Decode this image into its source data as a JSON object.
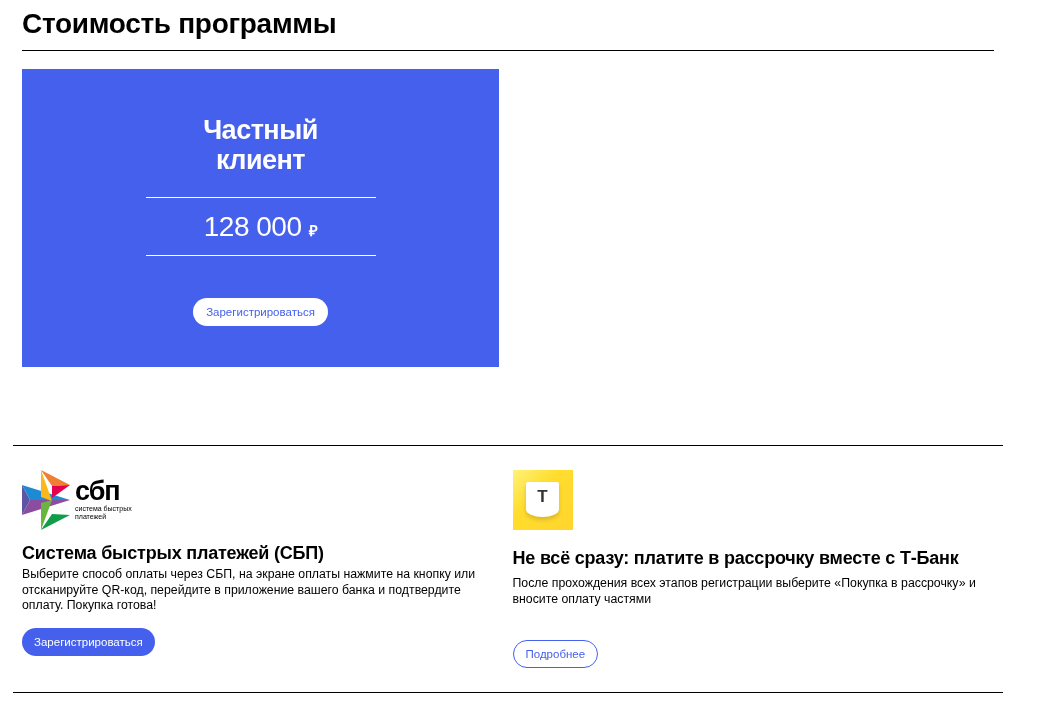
{
  "heading": "Стоимость программы",
  "plan": {
    "title": "Частный клиент",
    "price": "128 000",
    "currency": "₽",
    "button": "Зарегистрироваться"
  },
  "payments": [
    {
      "kind": "sbp",
      "logo_mark": "сбп",
      "logo_caption": "система быстрых платежей",
      "title": "Система быстрых платежей (СБП)",
      "text": "Выберите способ оплаты через СБП, на экране оплаты нажмите на кнопку или отсканируйте QR-код, перейдите в приложение вашего банка и подтвердите оплату. Покупка готова!",
      "button": {
        "label": "Зарегистрироваться",
        "kind": "filled"
      }
    },
    {
      "kind": "tbank",
      "logo_mark": "Т",
      "title": "Не всё сразу: платите в рассрочку вместе с Т-Банк",
      "text": "После прохождения всех этапов регистрации выберите «Покупка в рассрочку» и вносите оплату частями",
      "button": {
        "label": "Подробнее",
        "kind": "outline"
      }
    }
  ]
}
